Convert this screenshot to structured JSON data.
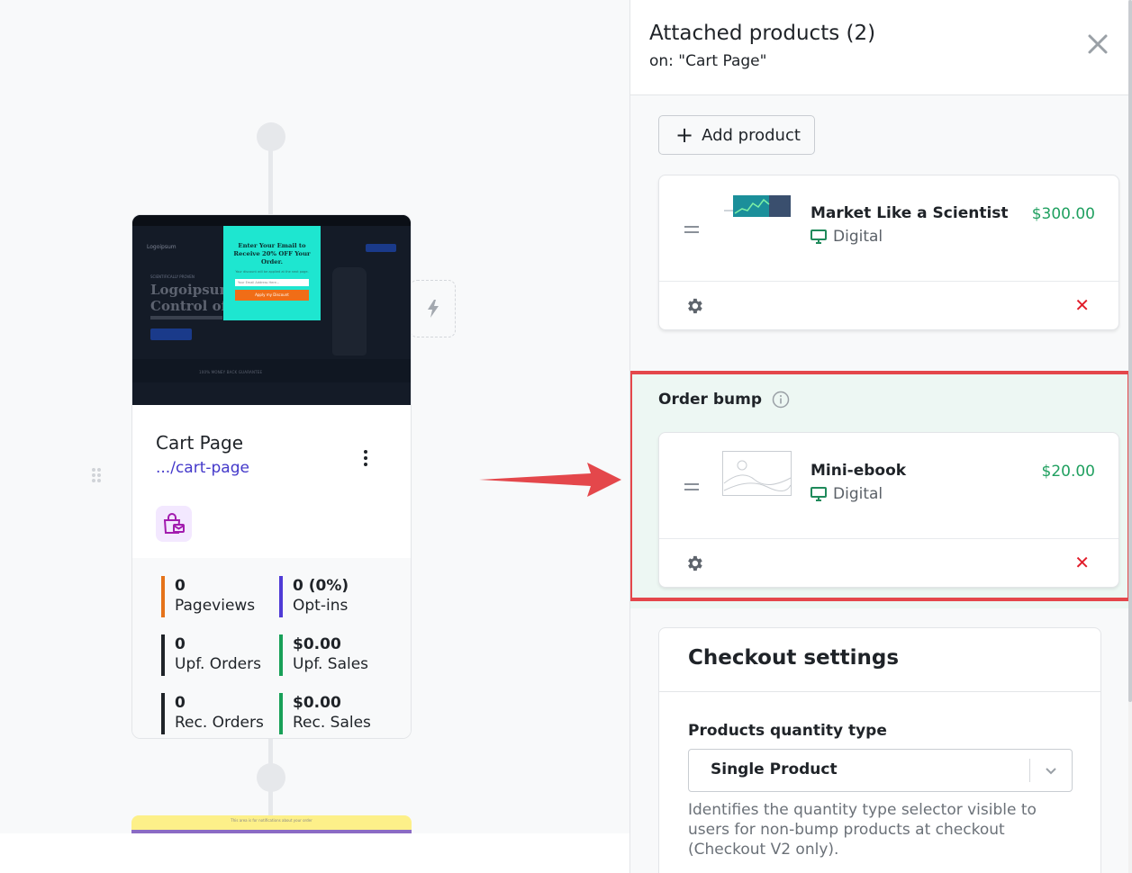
{
  "canvas": {
    "step_card": {
      "title": "Cart Page",
      "url": ".../cart-page",
      "thumbnail": {
        "popup_heading": "Enter Your Email to Receive 20% OFF Your Order.",
        "popup_sub": "Your discount will be applied at the next page.",
        "popup_input_placeholder": "Your Email Address Here...",
        "popup_button": "Apply my Discount",
        "logo_text": "Logoipsum",
        "hero_tag": "SCIENTIFICALLY PROVEN",
        "hero_line1": "Logoipsum",
        "hero_line2": "Control of",
        "band_text": "100% MONEY BACK GUARANTEE"
      },
      "stats": [
        {
          "value": "0",
          "label": "Pageviews",
          "color": "#e5731a"
        },
        {
          "value": "0 (0%)",
          "label": "Opt-ins",
          "color": "#4f3bd6"
        },
        {
          "value": "0",
          "label": "Upf. Orders",
          "color": "#1f2328"
        },
        {
          "value": "$0.00",
          "label": "Upf. Sales",
          "color": "#18a058"
        },
        {
          "value": "0",
          "label": "Rec. Orders",
          "color": "#1f2328"
        },
        {
          "value": "$0.00",
          "label": "Rec. Sales",
          "color": "#18a058"
        }
      ]
    },
    "next_card_text": "This area is for notifications about your order"
  },
  "panel": {
    "title": "Attached products (2)",
    "subtitle": "on: \"Cart Page\"",
    "add_product_label": "Add product",
    "products": [
      {
        "name": "Market Like a Scientist",
        "type": "Digital",
        "price": "$300.00"
      }
    ],
    "order_bump": {
      "label": "Order bump",
      "product": {
        "name": "Mini-ebook",
        "type": "Digital",
        "price": "$20.00"
      }
    },
    "checkout": {
      "title": "Checkout settings",
      "qty_label": "Products quantity type",
      "qty_value": "Single Product",
      "qty_help": "Identifies the quantity type selector visible to users for non-bump products at checkout (Checkout V2 only)."
    }
  },
  "colors": {
    "accent_green": "#20a060",
    "remove_red": "#e11d2a",
    "highlight_red": "#e4474b",
    "link_purple": "#4338ca"
  }
}
